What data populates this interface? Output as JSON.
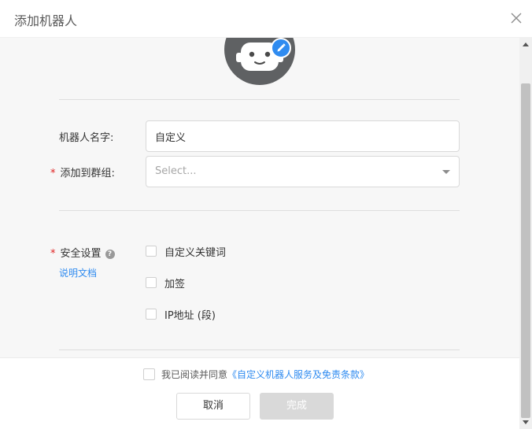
{
  "dialog": {
    "title": "添加机器人"
  },
  "form": {
    "name": {
      "label": "机器人名字:",
      "value": "自定义"
    },
    "group": {
      "label": "添加到群组:",
      "required_mark": "*",
      "placeholder": "Select..."
    },
    "security": {
      "label": "安全设置",
      "required_mark": "*",
      "help_link": "说明文档",
      "options": [
        {
          "label": "自定义关键词",
          "checked": false
        },
        {
          "label": "加签",
          "checked": false
        },
        {
          "label": "IP地址 (段)",
          "checked": false
        }
      ]
    }
  },
  "footer": {
    "agreement_prefix": "我已阅读并同意",
    "agreement_link": "《自定义机器人服务及免责条款》",
    "agreement_checked": false,
    "cancel_label": "取消",
    "done_label": "完成"
  },
  "colors": {
    "accent": "#2f8bf0",
    "required": "#e02020",
    "avatar_bg": "#5f6163",
    "disabled_button": "#d9d9d9"
  },
  "icons": {
    "close": "close-icon",
    "edit": "pencil-icon",
    "help": "question-circle-icon",
    "dropdown": "caret-down-icon",
    "avatar": "robot-icon"
  }
}
